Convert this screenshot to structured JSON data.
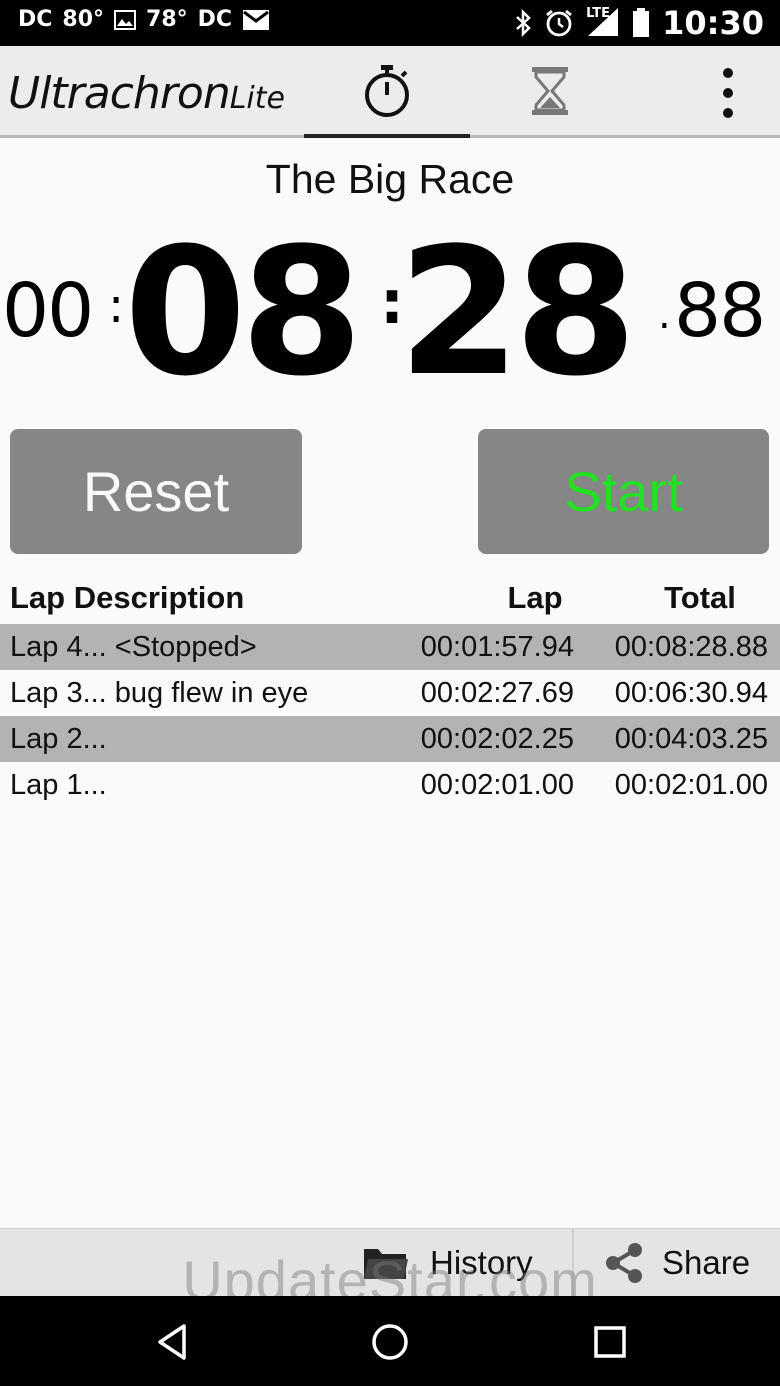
{
  "status_bar": {
    "left_items": [
      "DC",
      "80°",
      "78°",
      "DC"
    ],
    "time": "10:30",
    "network": "LTE",
    "icons": [
      "image-icon",
      "mail-icon",
      "bluetooth-icon",
      "alarm-icon",
      "signal-icon",
      "battery-icon"
    ]
  },
  "app_bar": {
    "brand_main": "Ultrachron",
    "brand_sub": "Lite",
    "tabs": [
      {
        "icon": "stopwatch-icon",
        "selected": true
      },
      {
        "icon": "hourglass-icon",
        "selected": false
      }
    ],
    "menu_icon": "more-vert-icon"
  },
  "stopwatch": {
    "title": "The Big Race",
    "hours": "00",
    "minutes": "08",
    "seconds": "28",
    "centis": "88",
    "sep": ":",
    "dot": "."
  },
  "buttons": {
    "reset": "Reset",
    "start": "Start",
    "start_color": "#22e022"
  },
  "laps": {
    "headers": {
      "desc": "Lap Description",
      "lap": "Lap",
      "total": "Total"
    },
    "rows": [
      {
        "desc": "Lap 4... <Stopped>",
        "lap": "00:01:57.94",
        "total": "00:08:28.88"
      },
      {
        "desc": "Lap 3... bug flew in eye",
        "lap": "00:02:27.69",
        "total": "00:06:30.94"
      },
      {
        "desc": "Lap 2...",
        "lap": "00:02:02.25",
        "total": "00:04:03.25"
      },
      {
        "desc": "Lap 1...",
        "lap": "00:02:01.00",
        "total": "00:02:01.00"
      }
    ]
  },
  "bottom_bar": {
    "history": "History",
    "share": "Share"
  },
  "watermark": "UpdateStar.com",
  "nav": {
    "icons": [
      "back-icon",
      "home-icon",
      "recents-icon"
    ]
  }
}
